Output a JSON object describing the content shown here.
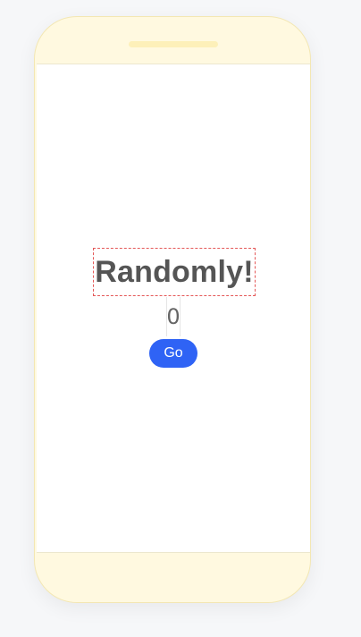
{
  "app": {
    "title": "Randomly!",
    "counter_value": "0",
    "go_label": "Go"
  },
  "colors": {
    "background": "#f6f7f9",
    "phone_frame": "#fff9e0",
    "accent_button": "#2f63f5",
    "title_text": "#555555",
    "dashed_outline": "#e45858"
  }
}
